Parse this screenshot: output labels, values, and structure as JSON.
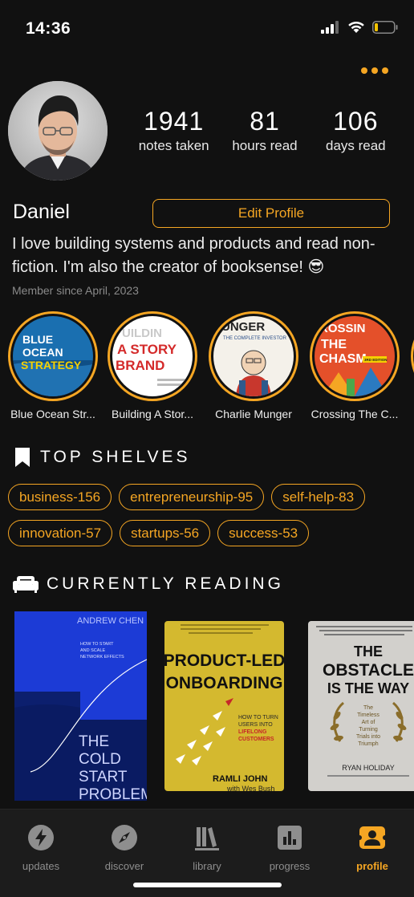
{
  "status": {
    "time": "14:36"
  },
  "profile": {
    "name": "Daniel",
    "edit_label": "Edit Profile",
    "bio": "I love building systems and products and read non-fiction. I'm also the creator of booksense! 😎",
    "member_since": "Member since April, 2023"
  },
  "stats": [
    {
      "value": "1941",
      "label": "notes taken"
    },
    {
      "value": "81",
      "label": "hours read"
    },
    {
      "value": "106",
      "label": "days read"
    }
  ],
  "stories": [
    {
      "label": "Blue Ocean Str...",
      "cover_lines": [
        "BLUE",
        "OCEAN",
        "STRATEGY"
      ]
    },
    {
      "label": "Building A Stor...",
      "cover_lines": [
        "UILDIN",
        "A STORY",
        "BRAND"
      ]
    },
    {
      "label": "Charlie Munger",
      "cover_lines": [
        "UNGER",
        "THE COMPLETE INVESTOR"
      ]
    },
    {
      "label": "Crossing The C...",
      "cover_lines": [
        "ROSSIN",
        "THE",
        "CHASM",
        "3RD EDITION"
      ]
    }
  ],
  "shelves": {
    "title": "TOP SHELVES",
    "tags": [
      "business-156",
      "entrepreneurship-95",
      "self-help-83",
      "innovation-57",
      "startups-56",
      "success-53"
    ]
  },
  "reading": {
    "title": "CURRENTLY READING",
    "books": [
      {
        "author": "ANDREW CHEN",
        "subtitle": "HOW TO START AND SCALE NETWORK EFFECTS",
        "title_lines": [
          "THE",
          "COLD",
          "START",
          "PROBLEM"
        ]
      },
      {
        "title_lines": [
          "PRODUCT-LED",
          "ONBOARDING"
        ],
        "subtitle": "HOW TO TURN USERS INTO",
        "highlight": "LIFELONG CUSTOMERS",
        "author": "RAMLI JOHN",
        "coauthor": "with Wes Bush"
      },
      {
        "title_lines": [
          "THE",
          "OBSTACLE",
          "IS THE WAY"
        ],
        "subtitle": "The Timeless Art of Turning Trials into Triumph",
        "author": "RYAN HOLIDAY"
      }
    ]
  },
  "tabs": [
    {
      "label": "updates",
      "icon": "lightning-icon"
    },
    {
      "label": "discover",
      "icon": "compass-icon"
    },
    {
      "label": "library",
      "icon": "library-icon"
    },
    {
      "label": "progress",
      "icon": "bar-chart-icon"
    },
    {
      "label": "profile",
      "icon": "profile-card-icon",
      "active": true
    }
  ],
  "colors": {
    "accent": "#f5a623",
    "background": "#111111",
    "tabbar": "#1c1c1c"
  }
}
